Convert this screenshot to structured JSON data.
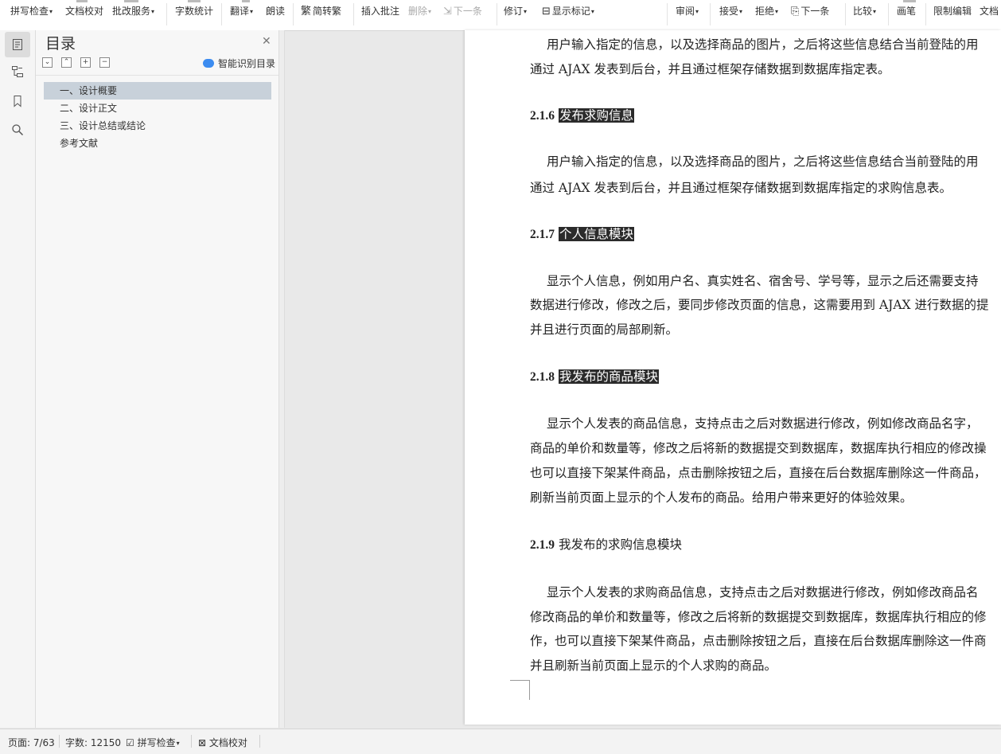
{
  "toolbar": {
    "spell_check": "拼写检查",
    "doc_proof": "文档校对",
    "revise_service": "批改服务",
    "word_count": "字数统计",
    "translate": "翻译",
    "read_aloud": "朗读",
    "simp_trad": "简转繁",
    "insert_comment": "插入批注",
    "delete": "删除",
    "next_comment": "下一条",
    "track_changes": "修订",
    "show_markup": "显示标记",
    "review": "审阅",
    "accept": "接受",
    "reject": "拒绝",
    "next_change": "下一条",
    "compare": "比较",
    "ink": "画笔",
    "restrict_edit": "限制编辑",
    "doc_more": "文档"
  },
  "nav": {
    "title": "目录",
    "smart_toc": "智能识别目录",
    "items": [
      {
        "label": "一、设计概要"
      },
      {
        "label": "二、设计正文"
      },
      {
        "label": "三、设计总结或结论"
      },
      {
        "label": "参考文献"
      }
    ]
  },
  "document": {
    "p1_l1": "用户输入指定的信息，以及选择商品的图片，之后将这些信息结合当前登陆的用",
    "p1_l2": "通过 AJAX 发表到后台，并且通过框架存储数据到数据库指定表。",
    "h216_num": "2.1.6",
    "h216_title": "发布求购信息",
    "p2_l1": "用户输入指定的信息，以及选择商品的图片，之后将这些信息结合当前登陆的用",
    "p2_l2": "通过 AJAX 发表到后台，并且通过框架存储数据到数据库指定的求购信息表。",
    "h217_num": "2.1.7",
    "h217_title": "个人信息模块",
    "p3_l1": "显示个人信息，例如用户名、真实姓名、宿舍号、学号等，显示之后还需要支持",
    "p3_l2": "数据进行修改，修改之后，要同步修改页面的信息，这需要用到 AJAX 进行数据的提",
    "p3_l3": "并且进行页面的局部刷新。",
    "h218_num": "2.1.8",
    "h218_title": "我发布的商品模块",
    "p4_l1": "显示个人发表的商品信息，支持点击之后对数据进行修改，例如修改商品名字，",
    "p4_l2": "商品的单价和数量等，修改之后将新的数据提交到数据库，数据库执行相应的修改操",
    "p4_l3": "也可以直接下架某件商品，点击删除按钮之后，直接在后台数据库删除这一件商品，",
    "p4_l4": "刷新当前页面上显示的个人发布的商品。给用户带来更好的体验效果。",
    "h219_num": "2.1.9",
    "h219_title": "我发布的求购信息模块",
    "p5_l1": "显示个人发表的求购商品信息，支持点击之后对数据进行修改，例如修改商品名",
    "p5_l2": "修改商品的单价和数量等，修改之后将新的数据提交到数据库，数据库执行相应的修",
    "p5_l3": "作，也可以直接下架某件商品，点击删除按钮之后，直接在后台数据库删除这一件商",
    "p5_l4": "并且刷新当前页面上显示的个人求购的商品。"
  },
  "status": {
    "page": "页面: 7/63",
    "words": "字数: 12150",
    "spell_check": "拼写检查",
    "doc_proof": "文档校对"
  }
}
